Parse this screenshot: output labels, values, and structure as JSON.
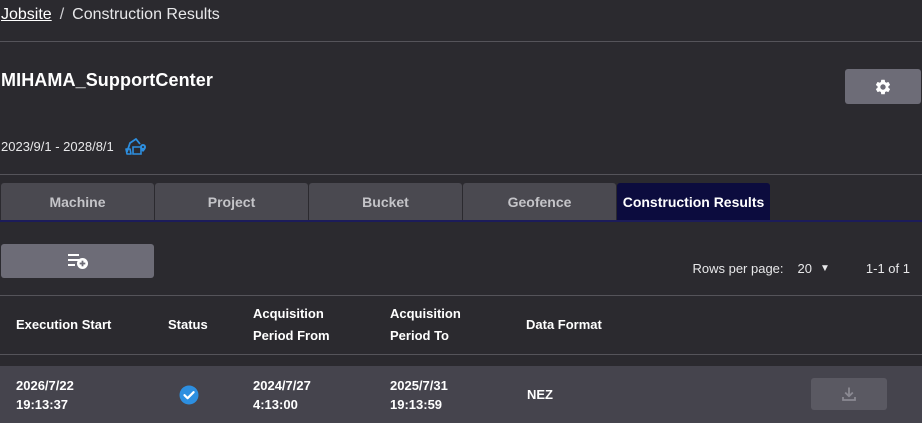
{
  "breadcrumb": {
    "parent": "Jobsite",
    "separator": "/",
    "current": "Construction Results"
  },
  "site": {
    "name": "MIHAMA_SupportCenter",
    "date_range": "2023/9/1 - 2028/8/1"
  },
  "tabs": [
    {
      "label": "Machine",
      "active": false
    },
    {
      "label": "Project",
      "active": false
    },
    {
      "label": "Bucket",
      "active": false
    },
    {
      "label": "Geofence",
      "active": false
    },
    {
      "label": "Construction Results",
      "active": true
    }
  ],
  "pagination": {
    "rows_per_page_label": "Rows per page:",
    "rows_per_page_value": "20",
    "range_text": "1-1 of 1"
  },
  "table": {
    "headers": [
      {
        "line1": "Execution Start",
        "line2": ""
      },
      {
        "line1": "Status",
        "line2": ""
      },
      {
        "line1": "Acquisition",
        "line2": "Period From"
      },
      {
        "line1": "Acquisition",
        "line2": "Period To"
      },
      {
        "line1": "Data Format",
        "line2": ""
      }
    ],
    "rows": [
      {
        "execution_start": [
          "2026/7/22",
          "19:13:37"
        ],
        "status": "completed",
        "period_from": [
          "2024/7/27",
          "4:13:00"
        ],
        "period_to": [
          "2025/7/31",
          "19:13:59"
        ],
        "data_format": "NEZ"
      }
    ]
  },
  "icons": {
    "settings": "gear-icon",
    "site_machine": "excavator-location-icon",
    "add_list": "add-list-icon",
    "status_ok": "check-circle-icon",
    "download": "download-icon"
  },
  "colors": {
    "background": "#2b2a2f",
    "active_tab": "#0c0c3e",
    "accent_blue": "#2d8fe0",
    "button": "#6d6c77"
  }
}
